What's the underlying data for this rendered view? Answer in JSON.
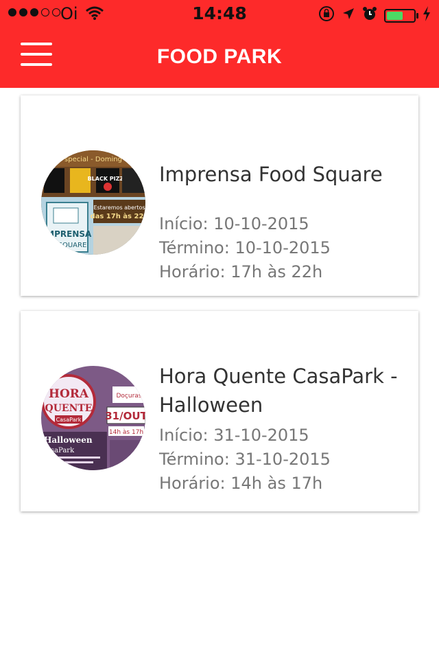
{
  "status_bar": {
    "carrier": "Oi",
    "time": "14:48",
    "signal_bars_filled": 3,
    "signal_bars_total": 5,
    "battery_level": 0.6,
    "battery_color": "#4cd964"
  },
  "nav": {
    "title": "FOOD PARK",
    "menu_icon": "hamburger-menu-icon",
    "background_color": "#fd2a2a"
  },
  "events": [
    {
      "name": "Imprensa Food Square",
      "start_label": "Início: 10-10-2015",
      "end_label": "Término: 10-10-2015",
      "hours_label": "Horário: 17h às 22h",
      "thumb_caption_top": "special - Doming",
      "thumb_logo_1": "BLACK PIZZA",
      "thumb_line_1": "Estaremos abertos",
      "thumb_line_2": "das 17h às 22h",
      "thumb_sign_1": "IMPRENSA",
      "thumb_sign_2": "D SQUARE"
    },
    {
      "name": "Hora Quente CasaPark - Halloween",
      "start_label": "Início: 31-10-2015",
      "end_label": "Término: 31-10-2015",
      "hours_label": "Horário: 14h às 17h",
      "thumb_title_1": "HORA",
      "thumb_title_2": "QUENTE",
      "thumb_sub": "CasaPark",
      "thumb_date": "31/OUT",
      "thumb_hours": "14h às 17h",
      "thumb_footer": "Halloween",
      "thumb_footer_2": "asaPark",
      "thumb_tag": "Doçuras"
    }
  ]
}
